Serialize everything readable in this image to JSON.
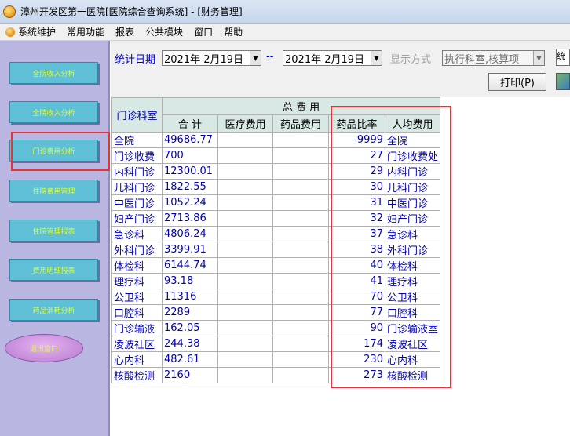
{
  "window": {
    "title": "漳州开发区第一医院[医院综合查询系统] - [财务管理]"
  },
  "menu": [
    "系统维护",
    "常用功能",
    "报表",
    "公共模块",
    "窗口",
    "帮助"
  ],
  "sidebar": {
    "buttons": [
      "全院收入分析",
      "全院收入分析",
      "门诊费用分析",
      "住院费用管理",
      "住院管理报表",
      "费用明细报表",
      "药品消耗分析"
    ],
    "oval": "退出窗口"
  },
  "toolbar": {
    "date_label": "统计日期",
    "start_date": "2021年 2月19日",
    "separator": "--",
    "end_date": "2021年 2月19日",
    "mode_label": "显示方式",
    "mode_value": "执行科室,核算项",
    "print_label": "打印(P)",
    "edge_text": "统"
  },
  "table": {
    "dept_header": "门诊科室",
    "group_header": "总 费 用",
    "columns": [
      "合  计",
      "医疗费用",
      "药品费用",
      "药品比率",
      "人均费用"
    ],
    "rows": [
      [
        "全院",
        "49686.77",
        "",
        "",
        "-9999",
        "全院"
      ],
      [
        "门诊收费",
        "700",
        "",
        "",
        "27",
        "门诊收费处"
      ],
      [
        "内科门诊",
        "12300.01",
        "",
        "",
        "29",
        "内科门诊"
      ],
      [
        "儿科门诊",
        "1822.55",
        "",
        "",
        "30",
        "儿科门诊"
      ],
      [
        "中医门诊",
        "1052.24",
        "",
        "",
        "31",
        "中医门诊"
      ],
      [
        "妇产门诊",
        "2713.86",
        "",
        "",
        "32",
        "妇产门诊"
      ],
      [
        "急诊科",
        "4806.24",
        "",
        "",
        "37",
        "急诊科"
      ],
      [
        "外科门诊",
        "3399.91",
        "",
        "",
        "38",
        "外科门诊"
      ],
      [
        "体检科",
        "6144.74",
        "",
        "",
        "40",
        "体检科"
      ],
      [
        "理疗科",
        "93.18",
        "",
        "",
        "41",
        "理疗科"
      ],
      [
        "公卫科",
        "11316",
        "",
        "",
        "70",
        "公卫科"
      ],
      [
        "口腔科",
        "2289",
        "",
        "",
        "77",
        "口腔科"
      ],
      [
        "门诊输液",
        "162.05",
        "",
        "",
        "90",
        "门诊输液室"
      ],
      [
        "凌波社区",
        "244.38",
        "",
        "",
        "174",
        "凌波社区"
      ],
      [
        "心内科",
        "482.61",
        "",
        "",
        "230",
        "心内科"
      ],
      [
        "核酸检测",
        "2160",
        "",
        "",
        "273",
        "核酸检测"
      ]
    ]
  },
  "colors": {
    "highlight": "#e8323a",
    "header_bg": "#d8e8e4",
    "sidebar_bg": "#b9b7e1",
    "button": "#5fbfd7"
  }
}
